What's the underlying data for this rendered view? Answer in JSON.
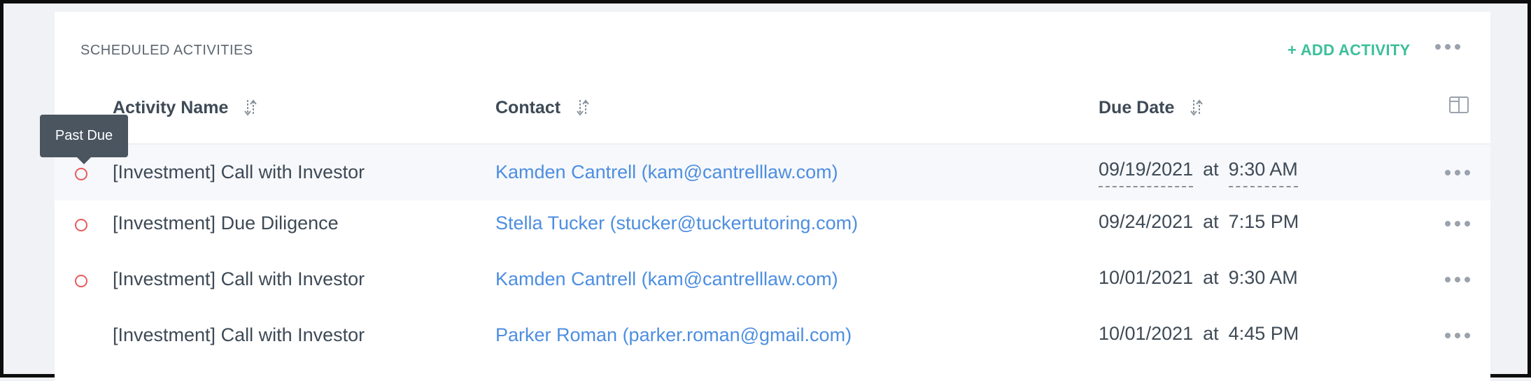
{
  "section": {
    "title": "SCHEDULED ACTIVITIES",
    "add_label": "+ ADD ACTIVITY"
  },
  "columns": {
    "activity": "Activity Name",
    "contact": "Contact",
    "due": "Due Date"
  },
  "tooltip": "Past Due",
  "at_label": "at",
  "rows": [
    {
      "name": "[Investment] Call with Investor",
      "contact": "Kamden Cantrell (kam@cantrelllaw.com)",
      "date": "09/19/2021",
      "time": "9:30 AM",
      "past_due": true
    },
    {
      "name": "[Investment] Due Diligence",
      "contact": "Stella Tucker (stucker@tuckertutoring.com)",
      "date": "09/24/2021",
      "time": "7:15 PM",
      "past_due": true
    },
    {
      "name": "[Investment] Call with Investor",
      "contact": "Kamden Cantrell (kam@cantrelllaw.com)",
      "date": "10/01/2021",
      "time": "9:30 AM",
      "past_due": true
    },
    {
      "name": "[Investment] Call with Investor",
      "contact": "Parker Roman (parker.roman@gmail.com)",
      "date": "10/01/2021",
      "time": "4:45 PM",
      "past_due": false
    }
  ],
  "icons": {
    "more": "more-horizontal-icon",
    "sort": "sort-icon",
    "columns": "columns-icon",
    "status": "status-circle-icon"
  },
  "colors": {
    "accent": "#3cbf9a",
    "link": "#4d8ee0",
    "past_due": "#e85b5b",
    "tooltip_bg": "#4a5560"
  }
}
